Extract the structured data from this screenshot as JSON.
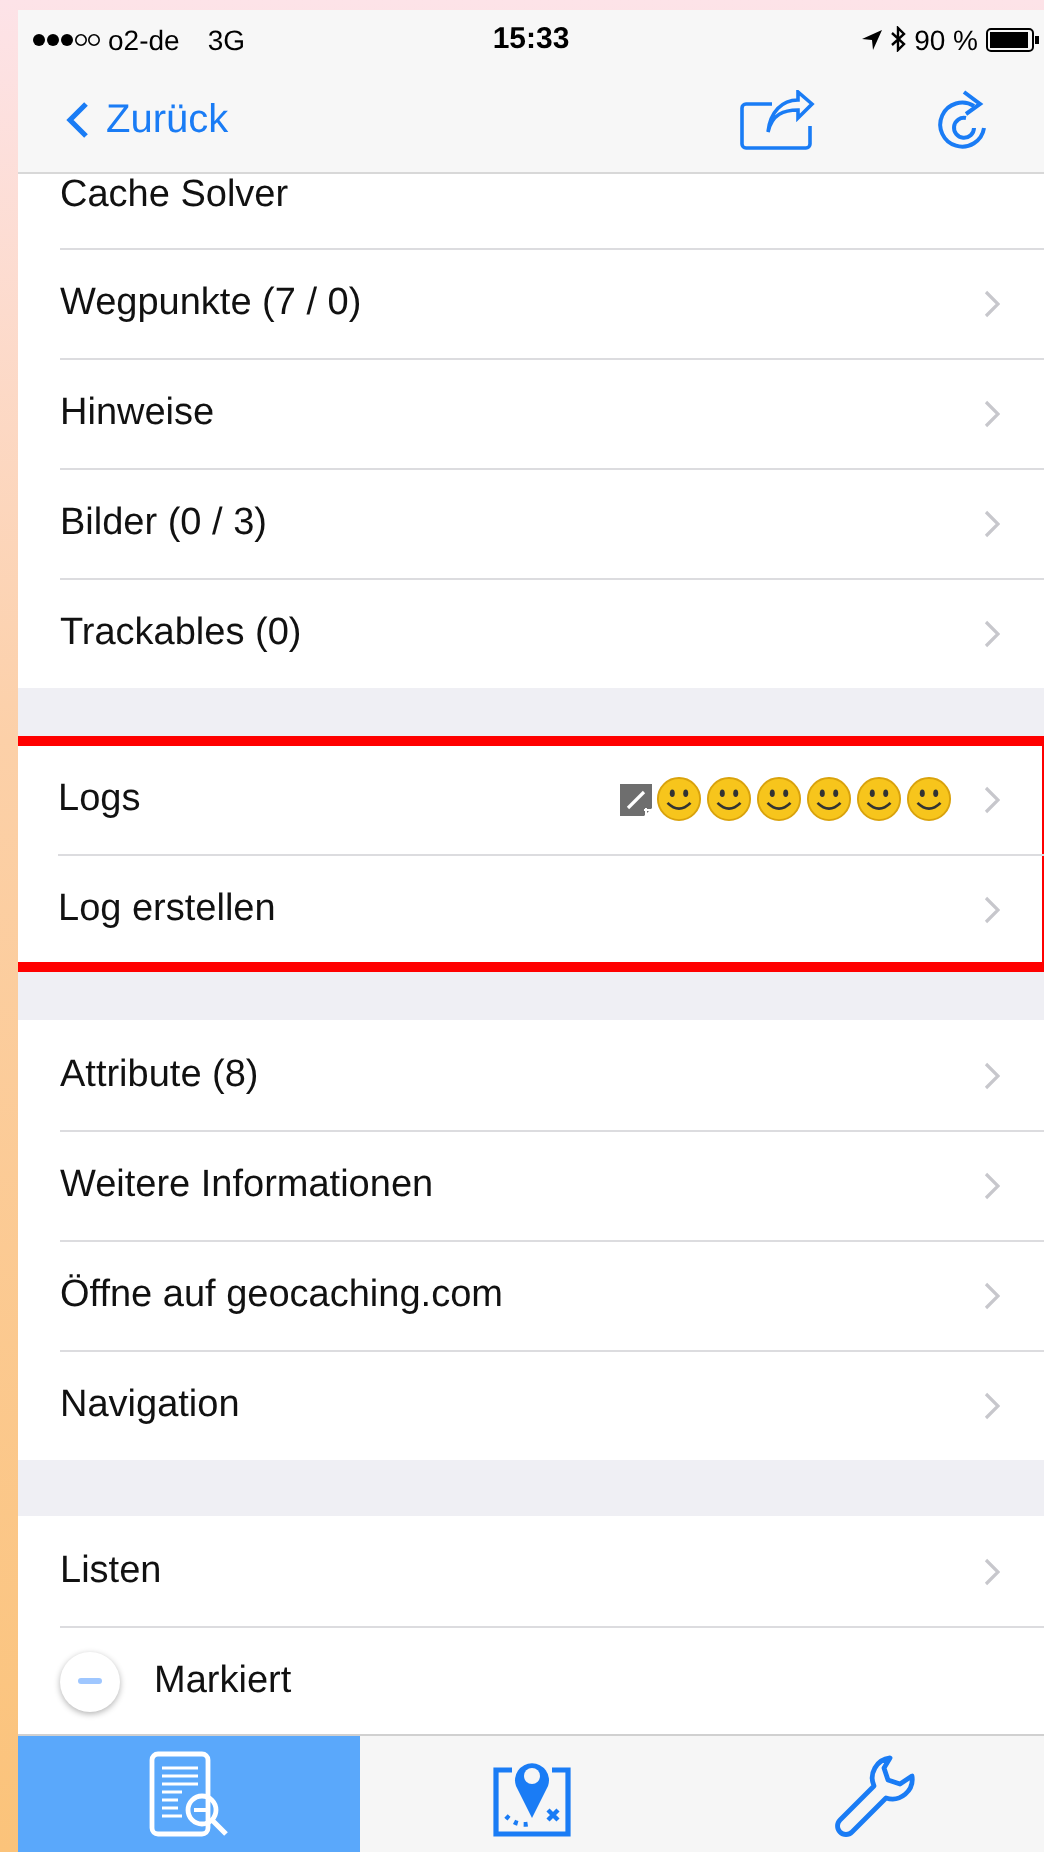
{
  "status_bar": {
    "carrier": "o2-de",
    "network": "3G",
    "time": "15:33",
    "battery": "90 %"
  },
  "nav_bar": {
    "back": "Zurück"
  },
  "sections": [
    {
      "highlighted": false,
      "rows": [
        {
          "kind": "cut",
          "label": "Cache Solver"
        },
        {
          "kind": "link",
          "label": "Wegpunkte (7 / 0)"
        },
        {
          "kind": "link",
          "label": "Hinweise"
        },
        {
          "kind": "link",
          "label": "Bilder (0 / 3)"
        },
        {
          "kind": "link",
          "label": "Trackables (0)"
        }
      ]
    },
    {
      "highlighted": true,
      "rows": [
        {
          "kind": "logs",
          "label": "Logs",
          "log_icons": [
            {
              "kind": "note"
            },
            {
              "kind": "found"
            },
            {
              "kind": "found"
            },
            {
              "kind": "found"
            },
            {
              "kind": "found"
            },
            {
              "kind": "found"
            },
            {
              "kind": "found"
            }
          ]
        },
        {
          "kind": "link",
          "label": "Log erstellen"
        }
      ]
    },
    {
      "highlighted": false,
      "rows": [
        {
          "kind": "link",
          "label": "Attribute (8)"
        },
        {
          "kind": "link",
          "label": "Weitere Informationen"
        },
        {
          "kind": "link",
          "label": "Öffne auf geocaching.com"
        },
        {
          "kind": "link",
          "label": "Navigation"
        }
      ]
    },
    {
      "highlighted": false,
      "rows": [
        {
          "kind": "link",
          "label": "Listen"
        },
        {
          "kind": "minus",
          "label": "Markiert"
        }
      ]
    }
  ],
  "tabs": [
    {
      "kind": "details",
      "selected": true
    },
    {
      "kind": "map",
      "selected": false
    },
    {
      "kind": "tools",
      "selected": false
    }
  ]
}
